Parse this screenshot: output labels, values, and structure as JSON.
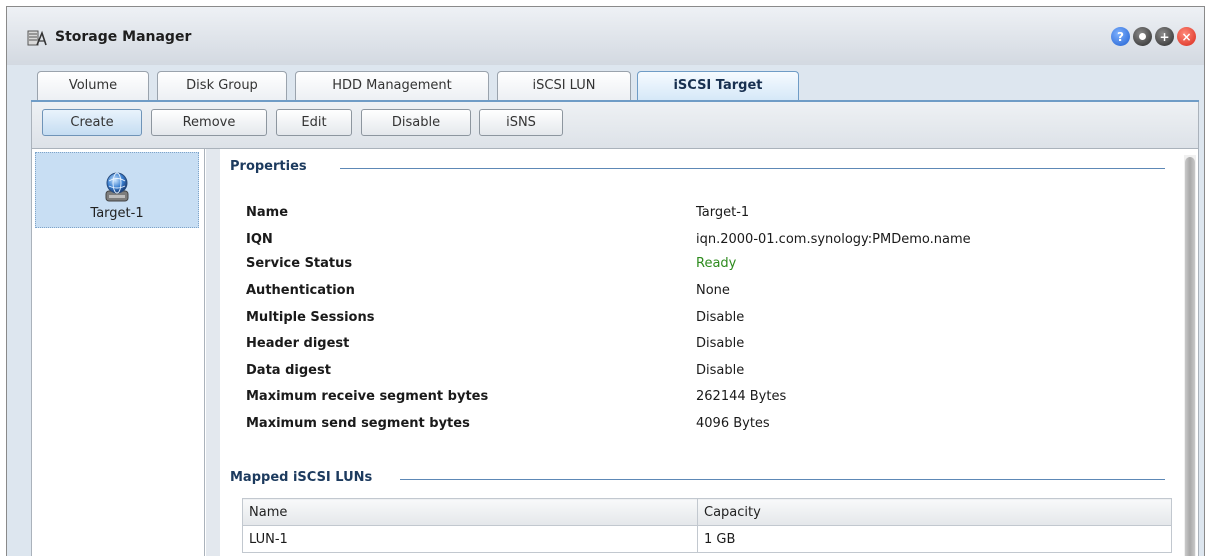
{
  "window": {
    "title": "Storage Manager",
    "icons": [
      "storage-manager-icon",
      "help-icon",
      "minimize-icon",
      "maximize-icon",
      "close-icon"
    ]
  },
  "tabs": [
    {
      "label": "Volume"
    },
    {
      "label": "Disk Group"
    },
    {
      "label": "HDD Management"
    },
    {
      "label": "iSCSI LUN"
    },
    {
      "label": "iSCSI Target",
      "active": true
    }
  ],
  "toolbar": {
    "create": "Create",
    "remove": "Remove",
    "edit": "Edit",
    "disable": "Disable",
    "isns": "iSNS"
  },
  "targets": [
    {
      "label": "Target-1",
      "icon": "globe-drive-icon"
    }
  ],
  "properties": {
    "section_title": "Properties",
    "rows": [
      {
        "label": "Name",
        "value": "Target-1"
      },
      {
        "label": "IQN",
        "value": "iqn.2000-01.com.synology:PMDemo.name"
      },
      {
        "label": "Service Status",
        "value": "Ready"
      },
      {
        "label": "Authentication",
        "value": "None"
      },
      {
        "label": "Multiple Sessions",
        "value": "Disable"
      },
      {
        "label": "Header digest",
        "value": "Disable"
      },
      {
        "label": "Data digest",
        "value": "Disable"
      },
      {
        "label": "Maximum receive segment bytes",
        "value": "262144 Bytes"
      },
      {
        "label": "Maximum send segment bytes",
        "value": "4096 Bytes"
      }
    ]
  },
  "mapped_luns": {
    "section_title": "Mapped iSCSI LUNs",
    "columns": [
      "Name",
      "Capacity"
    ],
    "rows": [
      [
        "LUN-1",
        "1 GB"
      ]
    ]
  },
  "colors": {
    "accent": "#6f9cc6",
    "ready": "#2e8b1e",
    "section_title": "#1c3a5e"
  }
}
